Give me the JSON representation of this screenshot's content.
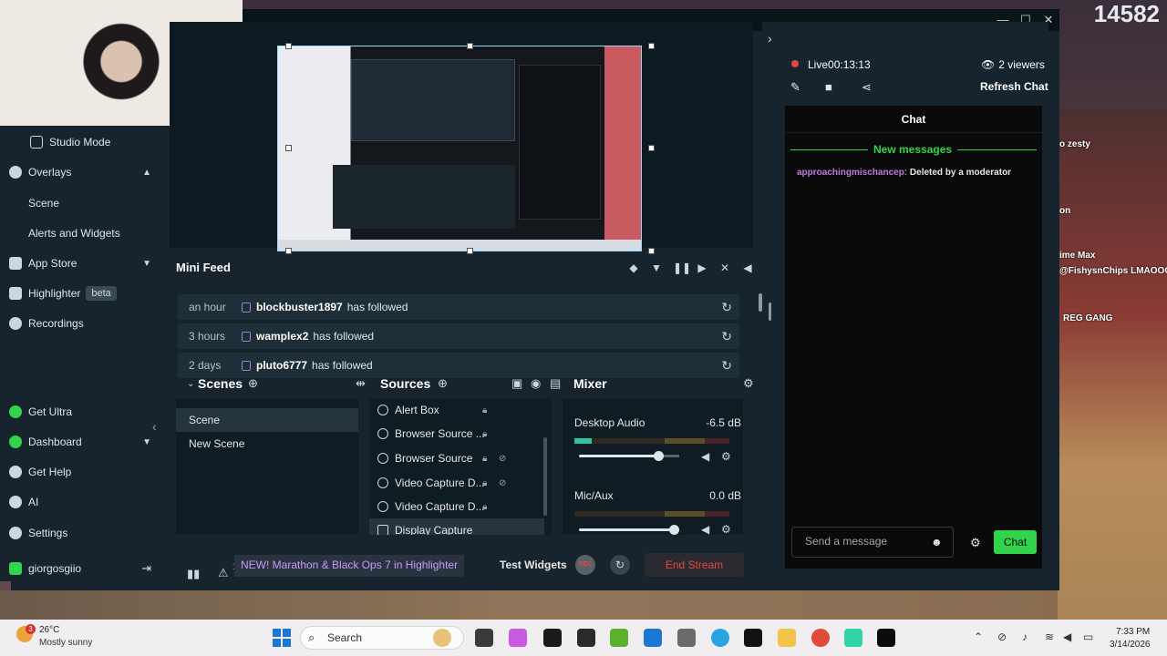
{
  "stream_overlay": {
    "viewer_count": "14582",
    "chat_lines": [
      "o zesty",
      "on",
      "ime Max",
      "@FishysnChips LMAOOOO",
      "REG GANG"
    ]
  },
  "sidebar": {
    "studio_mode": "Studio Mode",
    "overlays": "Overlays",
    "scene": "Scene",
    "alerts_widgets": "Alerts and Widgets",
    "app_store": "App Store",
    "highlighter": "Highlighter",
    "highlighter_badge": "beta",
    "recordings": "Recordings",
    "get_ultra": "Get Ultra",
    "dashboard": "Dashboard",
    "get_help": "Get Help",
    "ai": "AI",
    "settings": "Settings",
    "username": "giorgosgiio"
  },
  "mini_feed": {
    "title": "Mini Feed",
    "rows": [
      {
        "time": "an hour",
        "user": "blockbuster1897",
        "action": "has followed"
      },
      {
        "time": "3 hours",
        "user": "wamplex2",
        "action": "has followed"
      },
      {
        "time": "2 days",
        "user": "pluto6777",
        "action": "has followed"
      }
    ]
  },
  "scenes": {
    "title": "Scenes",
    "items": [
      "Scene",
      "New Scene"
    ]
  },
  "sources": {
    "title": "Sources",
    "items": [
      "Alert Box",
      "Browser Source ...",
      "Browser Source",
      "Video Capture D...",
      "Video Capture D...",
      "Display Capture"
    ]
  },
  "mixer": {
    "title": "Mixer",
    "channels": [
      {
        "name": "Desktop Audio",
        "db": "-6.5 dB",
        "level": 0.83
      },
      {
        "name": "Mic/Aux",
        "db": "0.0 dB",
        "level": 1.0
      }
    ]
  },
  "statusbar": {
    "alert_count": "1",
    "promo": "NEW! Marathon & Black Ops 7 in Highlighter",
    "test_widgets": "Test Widgets",
    "rec": "REC",
    "end_stream": "End Stream"
  },
  "live": {
    "label": "Live",
    "duration": "00:13:13",
    "viewers": "2 viewers",
    "refresh_chat": "Refresh Chat"
  },
  "chat": {
    "title": "Chat",
    "new_messages": "New messages",
    "message_user": "approachingmischancep:",
    "message_text": "Deleted by a moderator",
    "input_placeholder": "Send a message",
    "send_label": "Chat"
  },
  "taskbar": {
    "weather_badge": "3",
    "temperature": "26°C",
    "weather": "Mostly sunny",
    "search": "Search",
    "time": "7:33 PM",
    "date": "3/14/2026"
  },
  "colors": {
    "accent_green": "#31d44a",
    "live_red": "#e24a4a",
    "app_bg": "#17242d",
    "highlight_purple": "#c89cf6"
  }
}
